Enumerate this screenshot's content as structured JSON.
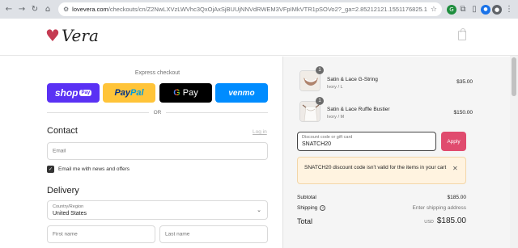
{
  "browser": {
    "url_host": "lovevera.com",
    "url_path": "/checkouts/cn/Z2NwLXVzLWVhc3QxOjAxSjBUUjNNVdRWEM3VFpIMkVTR1pSOVo2?_ga=2.85212121.1551176825.1718884573-105893..."
  },
  "brand": {
    "name": "Vera"
  },
  "express": {
    "label": "Express checkout",
    "shop_a": "shop",
    "shop_b": "Pay",
    "paypal_1": "Pay",
    "paypal_2": "Pal",
    "gpay_g": "G",
    "gpay_text": "Pay",
    "venmo": "venmo",
    "or": "OR"
  },
  "contact": {
    "title": "Contact",
    "login": "Log in",
    "email_placeholder": "Email",
    "newsletter_label": "Email me with news and offers",
    "newsletter_checked": true
  },
  "delivery": {
    "title": "Delivery",
    "country_label": "Country/Region",
    "country_value": "United States",
    "first_name_placeholder": "First name",
    "last_name_placeholder": "Last name"
  },
  "order": {
    "items": [
      {
        "name": "Satin & Lace G-String",
        "variant": "Ivory / L",
        "price": "$35.00",
        "qty": "1",
        "thumb": "g-string-photo"
      },
      {
        "name": "Satin & Lace Ruffle Bustier",
        "variant": "Ivory / M",
        "price": "$150.00",
        "qty": "1",
        "thumb": "bustier-photo"
      }
    ],
    "discount_label": "Discount code or gift card",
    "discount_value": "SNATCH20",
    "apply_label": "Apply",
    "alert_message": "SNATCH20 discount code isn't valid for the items in your cart",
    "subtotal_label": "Subtotal",
    "subtotal_value": "$185.00",
    "shipping_label": "Shipping",
    "shipping_value": "Enter shipping address",
    "total_label": "Total",
    "total_currency": "USD",
    "total_value": "$185.00"
  },
  "colors": {
    "accent": "#e04b6e",
    "shop_pay": "#5a31f4",
    "paypal": "#ffc439",
    "venmo": "#008cff",
    "alert_bg": "#fff3e0"
  }
}
